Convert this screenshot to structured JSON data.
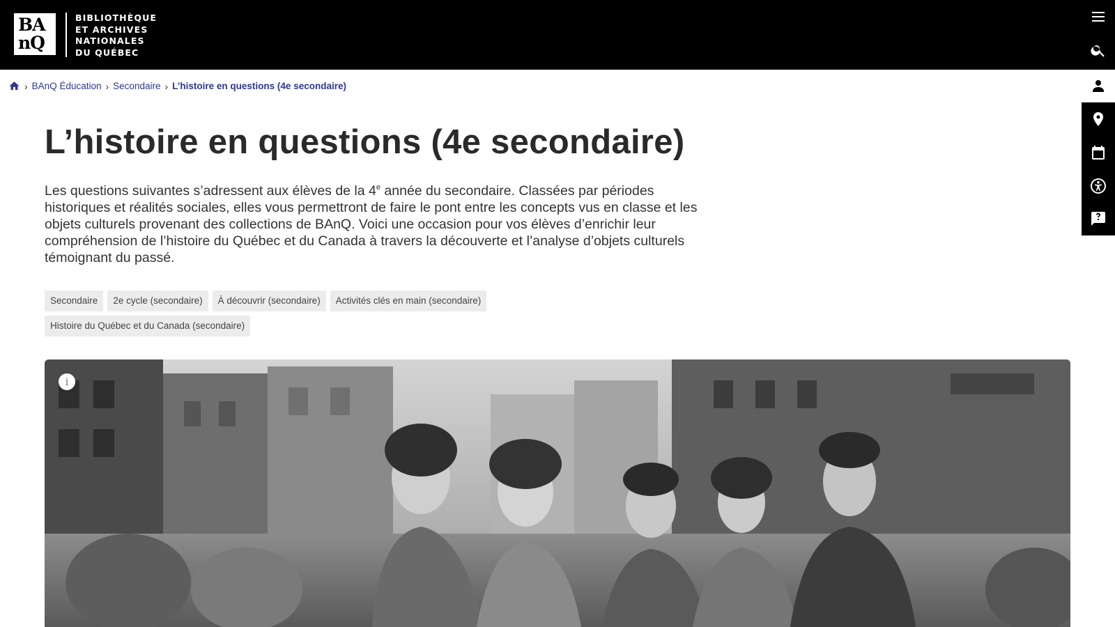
{
  "header": {
    "logo_mark": [
      "BA",
      "nQ"
    ],
    "logo_lines": [
      "BIBLIOTHÈQUE",
      "ET ARCHIVES",
      "NATIONALES",
      "DU QUÉBEC"
    ],
    "icons": [
      "menu-icon",
      "search-icon"
    ]
  },
  "rail": {
    "items": [
      "account-icon",
      "location-icon",
      "calendar-icon",
      "accessibility-icon",
      "feedback-icon"
    ]
  },
  "breadcrumb": {
    "items": [
      "BAnQ Éducation",
      "Secondaire"
    ],
    "current": "L’histoire en questions (4e secondaire)"
  },
  "page": {
    "title": "L’histoire en questions (4e secondaire)",
    "intro_part1": "Les questions suivantes s’adressent aux élèves de la 4",
    "intro_sup": "e",
    "intro_part2": " année du secondaire. Classées par périodes historiques et réalités sociales, elles vous permettront de faire le pont entre les concepts vus en classe et les objets culturels provenant des collections de BAnQ.  Voici une occasion pour vos élèves d’enrichir leur compréhension de l’histoire du Québec et du Canada à travers la découverte et l’analyse d’objets culturels témoignant du passé."
  },
  "tags": [
    "Secondaire",
    "2e cycle (secondaire)",
    "À découvrir (secondaire)",
    "Activités clés en main (secondaire)",
    "Histoire du Québec et du Canada (secondaire)"
  ],
  "hero": {
    "info_label": "i"
  },
  "colors": {
    "header_bg": "#000000",
    "link": "#2b3990",
    "tag_bg": "#ececec"
  }
}
